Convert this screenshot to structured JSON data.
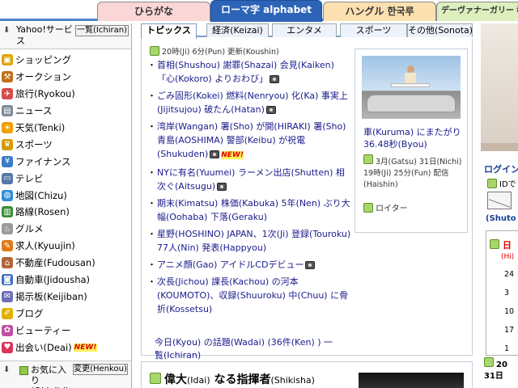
{
  "lang_tabs": {
    "hiragana": "ひらがな",
    "romaji": "ローマ字 alphabet",
    "hangul": "ハングル 한국루",
    "devanagari": "デーヴァナーガリー देवनागरी"
  },
  "sidebar": {
    "title": "Yahoo!サービス",
    "list_button": "一覧(Ichiran)",
    "items": [
      {
        "label": "ショッピング",
        "icon": "shopping-bag-icon",
        "color": "#e2a100",
        "new": false
      },
      {
        "label": "オークション",
        "icon": "auction-icon",
        "color": "#c27018",
        "new": false
      },
      {
        "label": "旅行(Ryokou)",
        "icon": "travel-icon",
        "color": "#d64b4b",
        "new": false
      },
      {
        "label": "ニュース",
        "icon": "news-icon",
        "color": "#7b8b99",
        "new": false
      },
      {
        "label": "天気(Tenki)",
        "icon": "weather-icon",
        "color": "#f0a000",
        "new": false
      },
      {
        "label": "スポーツ",
        "icon": "trophy-icon",
        "color": "#d49b00",
        "new": false
      },
      {
        "label": "ファイナンス",
        "icon": "finance-icon",
        "color": "#3b7bc8",
        "new": false
      },
      {
        "label": "テレビ",
        "icon": "tv-icon",
        "color": "#5477a8",
        "new": false
      },
      {
        "label": "地図(Chizu)",
        "icon": "globe-icon",
        "color": "#2f8ed6",
        "new": false
      },
      {
        "label": "路線(Rosen)",
        "icon": "train-icon",
        "color": "#3a8e3a",
        "new": false
      },
      {
        "label": "グルメ",
        "icon": "gourmet-icon",
        "color": "#9a9a9a",
        "new": false
      },
      {
        "label": "求人(Kyuujin)",
        "icon": "jobs-icon",
        "color": "#e07a18",
        "new": false
      },
      {
        "label": "不動産(Fudousan)",
        "icon": "real-estate-icon",
        "color": "#b2643c",
        "new": false
      },
      {
        "label": "自動車(Jidousha)",
        "icon": "car-icon",
        "color": "#3f70c4",
        "new": false
      },
      {
        "label": "掲示板(Keijiban)",
        "icon": "bbs-icon",
        "color": "#6d6db8",
        "new": false
      },
      {
        "label": "ブログ",
        "icon": "blog-icon",
        "color": "#e0b000",
        "new": false
      },
      {
        "label": "ビューティー",
        "icon": "beauty-icon",
        "color": "#c04fa0",
        "new": false
      },
      {
        "label": "出会い(Deai)",
        "icon": "heart-icon",
        "color": "#e0305a",
        "new": true
      }
    ],
    "new_badge": "NEW!",
    "favorites_label": "お気に入り(Okiniiri)",
    "change_button": "変更(Henkou)"
  },
  "topics": {
    "tabs": [
      "トピックス",
      "経済(Keizai)",
      "エンタメ",
      "スポーツ",
      "その他(Sonota)"
    ],
    "updated": "20時(Ji) 6分(Pun) 更新(Koushin)",
    "headlines": [
      {
        "text": "首相(Shushou) 謝罪(Shazai) 会見(Kaiken) 「心(Kokoro) よりおわび」",
        "camera": true,
        "new": false
      },
      {
        "text": "ごみ固形(Kokei) 燃料(Nenryou) 化(Ka) 事実上(Jijitsujou) 破たん(Hatan)",
        "camera": true,
        "new": false
      },
      {
        "text": "湾岸(Wangan) 署(Sho) が開(HIRAKI) 署(Sho) 青島(AOSHIMA) 警部(Keibu) が祝電(Shukuden)",
        "camera": true,
        "new": true
      },
      {
        "text": "NYに有名(Yuumei) ラーメン出店(Shutten) 相次ぐ(Aitsugu)",
        "camera": true,
        "new": false
      },
      {
        "text": "期末(Kimatsu) 株価(Kabuka) 5年(Nen) ぶり大幅(Oohaba) 下落(Geraku)",
        "camera": false,
        "new": false
      },
      {
        "text": "星野(HOSHINO) JAPAN、1次(Ji) 登録(Touroku) 77人(Nin) 発表(Happyou)",
        "camera": false,
        "new": false
      },
      {
        "text": "アニメ顔(Gao) アイドルCDデビュー",
        "camera": true,
        "new": false
      },
      {
        "text": "次長(Jichou) 課長(Kachou) の河本(KOUMOTO)、収録(Shuuroku) 中(Chuu) に骨折(Kossetsu)",
        "camera": false,
        "new": false
      }
    ],
    "new_badge": "NEW!",
    "footer": "今日(Kyou) の話題(Wadai) (36件(Ken) ) 一覧(Ichiran)"
  },
  "photo": {
    "caption": "車(Kuruma) にまたがり36.48秒(Byou)",
    "meta": "3月(Gatsu) 31日(Nichi) 19時(Ji) 25分(Fun) 配信(Haishin)",
    "source": "ロイター"
  },
  "feature": {
    "title_main": "偉大",
    "title_reading1": "(Idai)",
    "title_mid": " なる指揮者",
    "title_reading2": "(Shikisha)"
  },
  "right": {
    "login_title": "ログイン",
    "login_id": "IDで",
    "mail_label": "(Shuto",
    "cal_head": "日",
    "cal_sub": "(Hi)",
    "cal_nums": [
      "24",
      "3",
      "10",
      "17",
      "1"
    ],
    "cal_date_line1": "20",
    "cal_date_line2": "31日"
  }
}
